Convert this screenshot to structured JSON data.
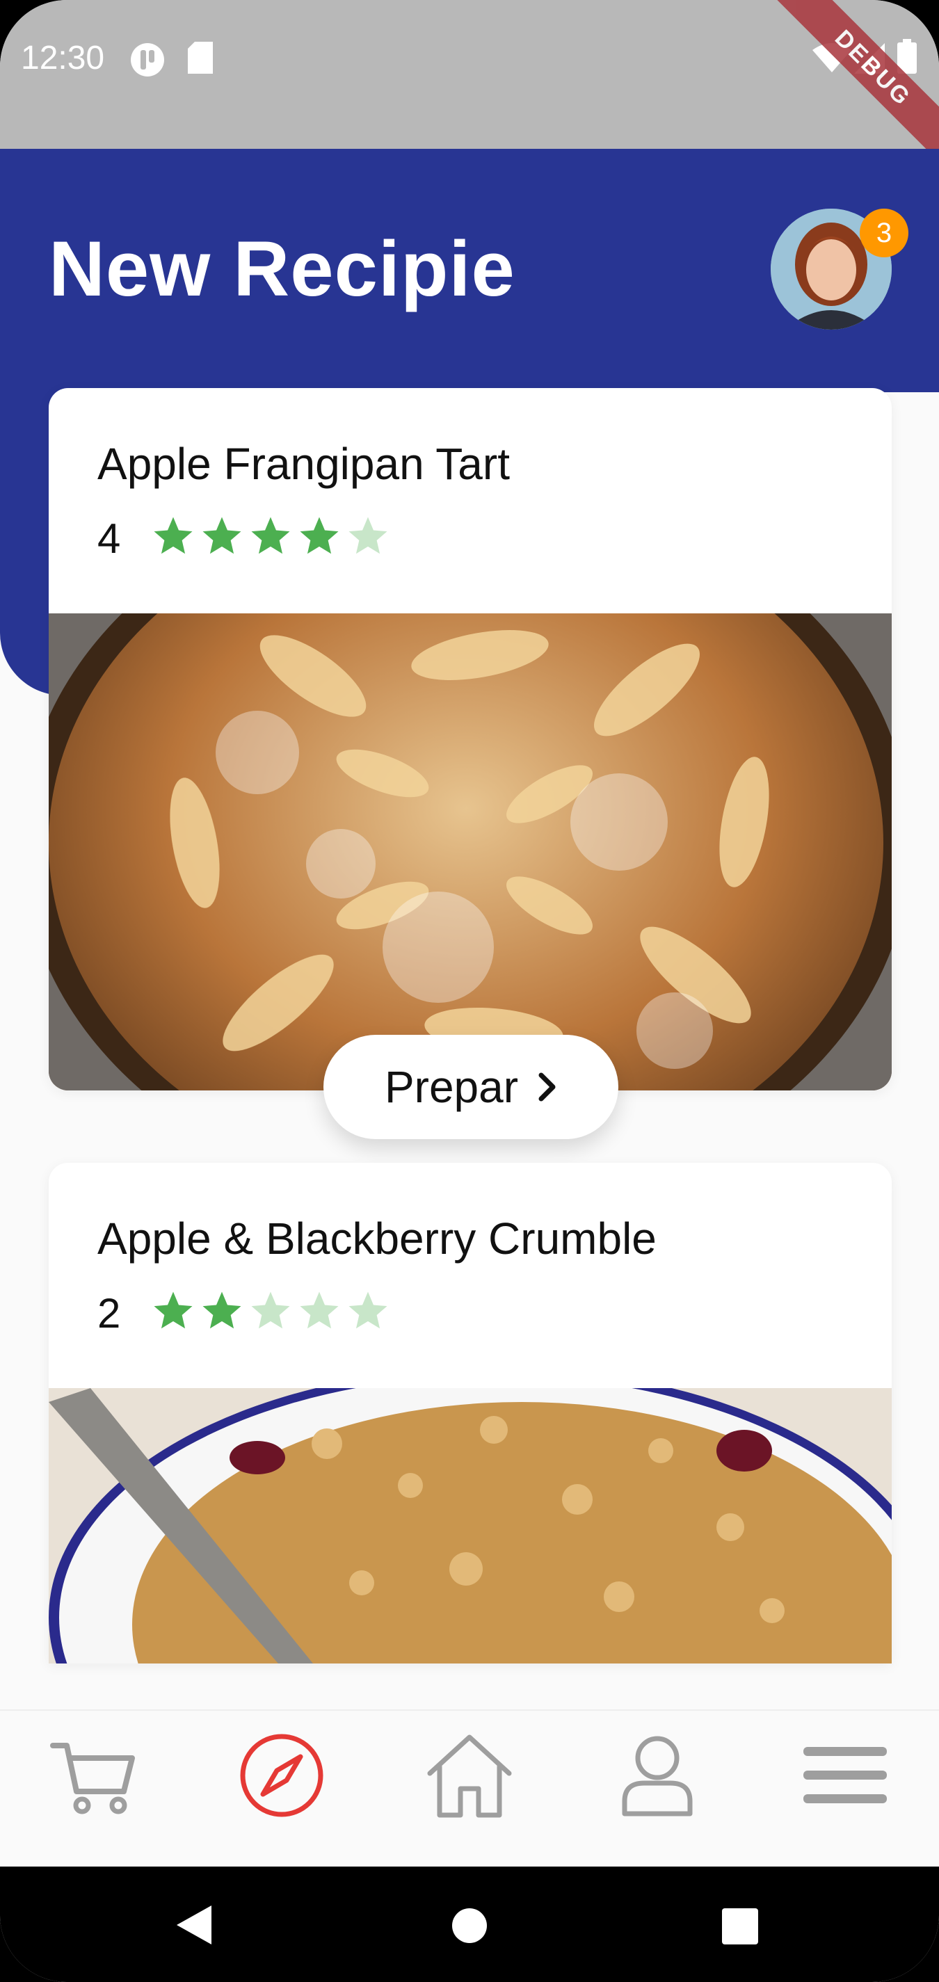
{
  "status_bar": {
    "time": "12:30",
    "debug_label": "DEBUG"
  },
  "header": {
    "title": "New Recipie",
    "notification_count": "3"
  },
  "recipes": [
    {
      "title": "Apple Frangipan Tart",
      "rating": "4",
      "stars_filled": 4,
      "stars_total": 5
    },
    {
      "title": "Apple & Blackberry Crumble",
      "rating": "2",
      "stars_filled": 2,
      "stars_total": 5
    }
  ],
  "prepare_button": {
    "label": "Prepar"
  },
  "bottom_nav": {
    "items": [
      {
        "icon": "cart-icon",
        "active": false
      },
      {
        "icon": "compass-icon",
        "active": true
      },
      {
        "icon": "home-icon",
        "active": false
      },
      {
        "icon": "profile-icon",
        "active": false
      },
      {
        "icon": "menu-icon",
        "active": false
      }
    ]
  },
  "colors": {
    "header": "#283593",
    "star": "#4caf50",
    "star_empty": "#c8e6c9",
    "badge": "#ff9800",
    "active_nav": "#e53935",
    "inactive_nav": "#9e9e9e"
  }
}
